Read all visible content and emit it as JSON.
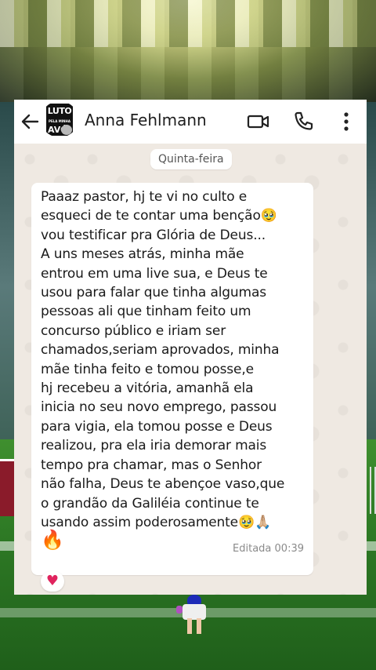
{
  "header": {
    "contact_name": "Anna Fehlmann",
    "avatar_text_top": "LUTO",
    "avatar_text_mid": "PELA MINHA",
    "avatar_text_bottom": "AVÓ"
  },
  "date_chip": "Quinta-feira",
  "message": {
    "text": "Paaaz pastor, hj te vi no culto e\nesqueci de te contar uma benção🥹\nvou testificar pra Glória de Deus...\nA uns meses atrás, minha mãe\nentrou em uma live sua, e Deus te\nusou para falar que tinha algumas\npessoas ali que tinham feito um\nconcurso público e iriam ser\nchamados,seriam aprovados, minha\nmãe tinha feito e tomou posse,e\nhj recebeu a vitória, amanhã ela\ninicia no seu novo emprego, passou\npara vigia, ela tomou posse e Deus\nrealizou, pra ela iria demorar mais\ntempo pra  chamar, mas o Senhor\nnão falha, Deus te abençoe vaso,que\no grandão da Galiléia continue te\nusando assim poderosamente🥹🙏🏼",
    "extra_emoji": "🔥",
    "meta": "Editada 00:39",
    "reaction": "♥"
  }
}
